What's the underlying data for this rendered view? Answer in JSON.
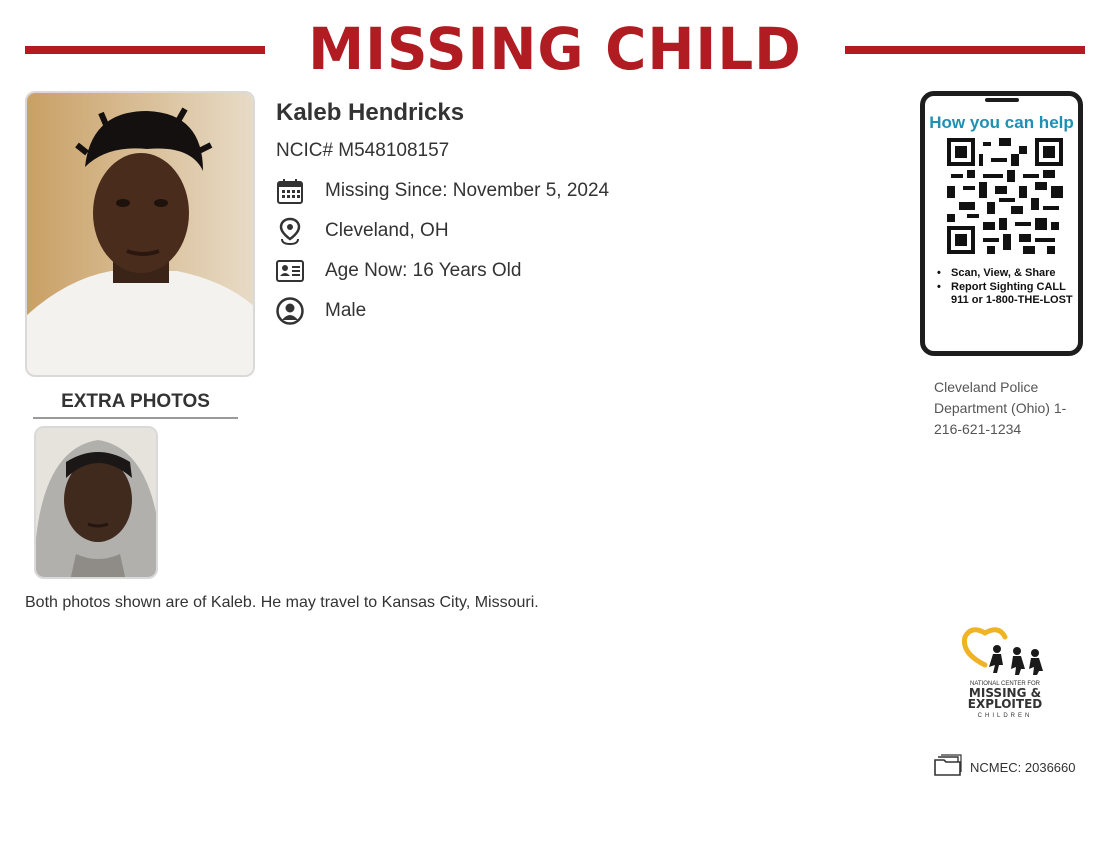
{
  "header": {
    "title": "MISSING CHILD"
  },
  "child": {
    "name": "Kaleb Hendricks",
    "ncic": "NCIC# M548108157",
    "missing_since": "Missing Since: November 5, 2024",
    "location": "Cleveland, OH",
    "age_now": "Age Now: 16 Years Old",
    "sex": "Male"
  },
  "extra_photos_label": "EXTRA PHOTOS",
  "note": "Both photos shown are of Kaleb. He may travel to Kansas City, Missouri.",
  "help_card": {
    "title": "How you can help",
    "bullets": [
      "Scan, View, & Share",
      "Report Sighting CALL 911 or 1-800-THE-LOST"
    ]
  },
  "contact": "Cleveland Police Department (Ohio) 1-216-621-1234",
  "logo": {
    "line1": "NATIONAL CENTER FOR",
    "line2": "MISSING &",
    "line3": "EXPLOITED",
    "line4": "CHILDREN"
  },
  "case_number": "NCMEC: 2036660",
  "colors": {
    "accent": "#b01c22",
    "help_title": "#1f8fb4"
  },
  "icons": [
    "calendar-icon",
    "location-pin-icon",
    "id-card-icon",
    "person-icon",
    "folder-icon"
  ]
}
